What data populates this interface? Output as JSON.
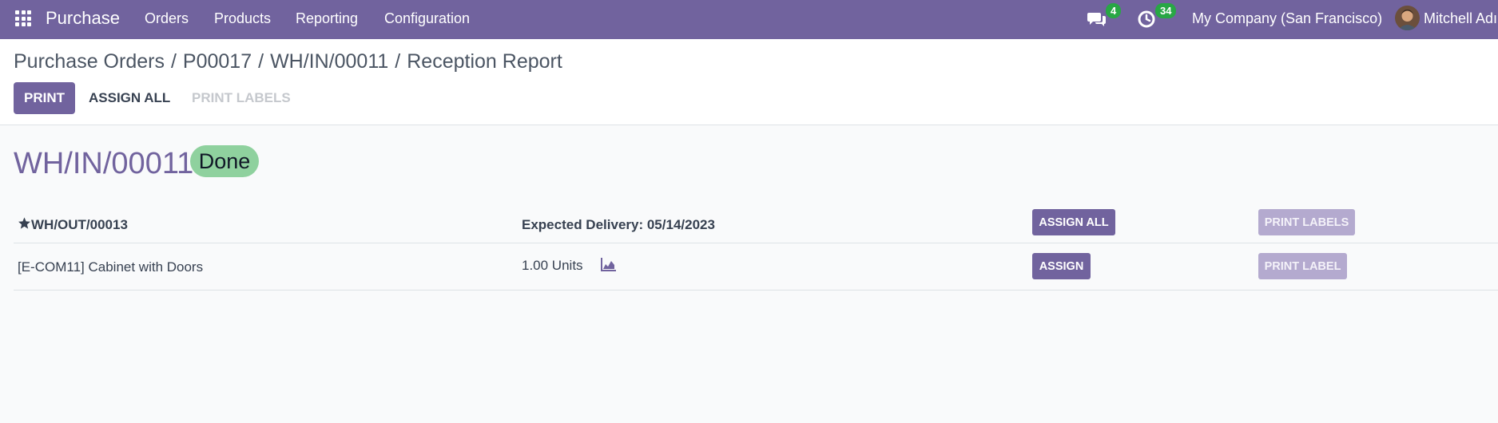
{
  "navbar": {
    "app_name": "Purchase",
    "menu": [
      "Orders",
      "Products",
      "Reporting",
      "Configuration"
    ],
    "messages_count": "4",
    "activities_count": "34",
    "company": "My Company (San Francisco)",
    "user": "Mitchell Adı"
  },
  "breadcrumb": [
    "Purchase Orders",
    "P00017",
    "WH/IN/00011",
    "Reception Report"
  ],
  "breadcrumb_separator": "/",
  "actions": {
    "print": "PRINT",
    "assign_all": "ASSIGN ALL",
    "print_labels": "PRINT LABELS"
  },
  "record": {
    "name": "WH/IN/00011",
    "state": "Done"
  },
  "report": {
    "header": {
      "picking": "WH/OUT/00013",
      "expected_delivery": "Expected Delivery: 05/14/2023",
      "assign_all": "ASSIGN ALL",
      "print_labels": "PRINT LABELS"
    },
    "lines": [
      {
        "product": "[E-COM11] Cabinet with Doors",
        "quantity": "1.00 Units",
        "assign": "ASSIGN",
        "print_label": "PRINT LABEL"
      }
    ]
  },
  "colors": {
    "brand": "#71639e",
    "done_badge": "#8fd19e",
    "counter_badge": "#28a745",
    "disabled_button": "#b4aacf"
  }
}
